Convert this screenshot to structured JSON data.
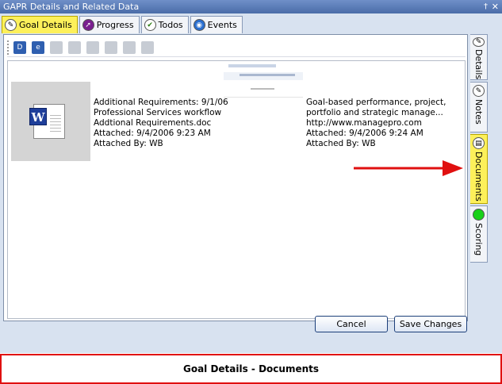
{
  "window": {
    "title": "GAPR Details and Related Data",
    "pin": "†",
    "close": "✕"
  },
  "tabs": [
    {
      "label": "Goal Details",
      "icon": "pencil-icon",
      "active": true
    },
    {
      "label": "Progress",
      "icon": "progress-arrow-icon",
      "active": false
    },
    {
      "label": "Todos",
      "icon": "checkmark-icon",
      "active": false
    },
    {
      "label": "Events",
      "icon": "events-icon",
      "active": false
    }
  ],
  "toolbar": {
    "buttons": [
      {
        "name": "attach-document-icon",
        "enabled": true
      },
      {
        "name": "attach-link-icon",
        "enabled": true
      },
      {
        "name": "open-document-icon",
        "enabled": false
      },
      {
        "name": "copy-document-icon",
        "enabled": false
      },
      {
        "name": "link-document-icon",
        "enabled": false
      },
      {
        "name": "properties-icon",
        "enabled": false
      },
      {
        "name": "edit-icon",
        "enabled": false
      },
      {
        "name": "save-icon",
        "enabled": false
      }
    ]
  },
  "documents": [
    {
      "title": "Additional Requirements: 9/1/06",
      "subtitle": "Professional Services workflow",
      "file": "Addtional Requirements.doc",
      "attached": "Attached: 9/4/2006 9:23 AM",
      "attached_by": "Attached By: WB"
    },
    {
      "title": "Goal-based performance, project,",
      "subtitle": "portfolio and strategic manage...",
      "file": "http://www.managepro.com",
      "attached": "Attached: 9/4/2006 9:24 AM",
      "attached_by": "Attached By: WB"
    }
  ],
  "side_tabs": [
    {
      "label": "Details",
      "icon": "pencil-icon",
      "active": false
    },
    {
      "label": "Notes",
      "icon": "notes-icon",
      "active": false
    },
    {
      "label": "Documents",
      "icon": "documents-icon",
      "active": true
    },
    {
      "label": "Scoring",
      "icon": "scoring-icon",
      "active": false
    }
  ],
  "buttons": {
    "cancel": "Cancel",
    "save": "Save Changes"
  },
  "caption": "Goal Details - Documents",
  "colors": {
    "highlight": "#fdf05a",
    "arrow": "#e01010",
    "caption_border": "#e01010"
  }
}
